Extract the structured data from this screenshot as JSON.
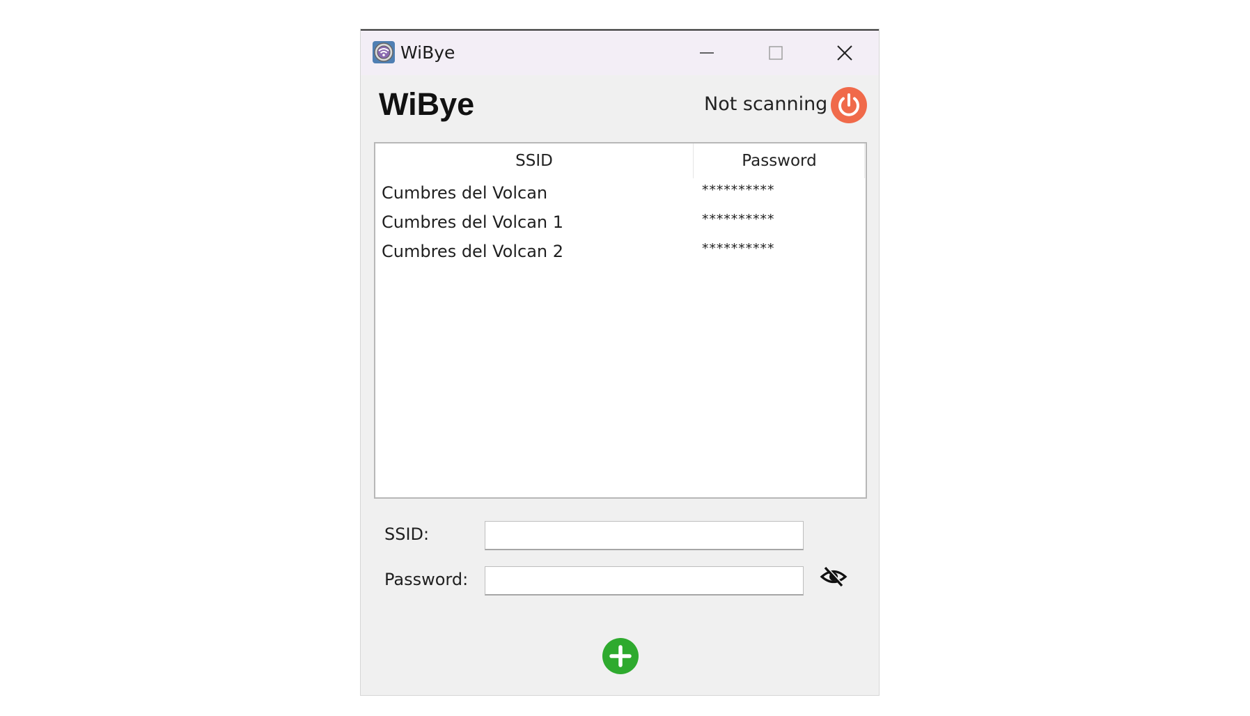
{
  "window": {
    "title": "WiBye",
    "app_icon": "wifi-shield-icon"
  },
  "titlebar_buttons": {
    "minimize_icon": "minimize-icon",
    "maximize_icon": "maximize-icon",
    "close_icon": "close-icon"
  },
  "header": {
    "title": "WiBye",
    "status": "Not scanning",
    "power_icon": "power-icon",
    "power_color": "#f06a4a"
  },
  "table": {
    "columns": [
      "SSID",
      "Password"
    ],
    "rows": [
      {
        "ssid": "Cumbres del Volcan",
        "password": "**********"
      },
      {
        "ssid": "Cumbres del Volcan 1",
        "password": "**********"
      },
      {
        "ssid": "Cumbres del Volcan 2",
        "password": "**********"
      }
    ]
  },
  "form": {
    "ssid_label": "SSID:",
    "ssid_value": "",
    "password_label": "Password:",
    "password_value": "",
    "toggle_visibility_icon": "eye-slash-icon",
    "add_icon": "plus-circle-icon",
    "add_color": "#2eaa2e"
  }
}
